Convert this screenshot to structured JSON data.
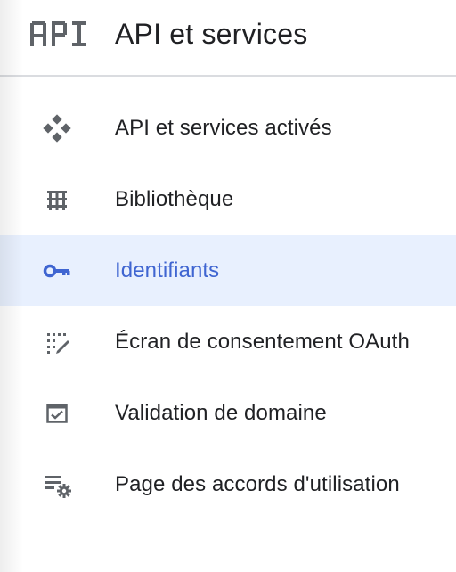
{
  "header": {
    "logo_text": "API",
    "title": "API et services"
  },
  "nav": {
    "items": [
      {
        "label": "API et services activés",
        "icon": "apis-grid-icon",
        "active": false
      },
      {
        "label": "Bibliothèque",
        "icon": "library-icon",
        "active": false
      },
      {
        "label": "Identifiants",
        "icon": "key-icon",
        "active": true
      },
      {
        "label": "Écran de consentement OAuth",
        "icon": "consent-screen-icon",
        "active": false
      },
      {
        "label": "Validation de domaine",
        "icon": "domain-verification-icon",
        "active": false
      },
      {
        "label": "Page des accords d'utilisation",
        "icon": "agreements-settings-icon",
        "active": false
      }
    ]
  },
  "colors": {
    "active_background": "#e8f0fe",
    "active_text": "#3f65d1",
    "text": "#202124",
    "icon": "#5f6368",
    "divider": "#dadce0"
  }
}
